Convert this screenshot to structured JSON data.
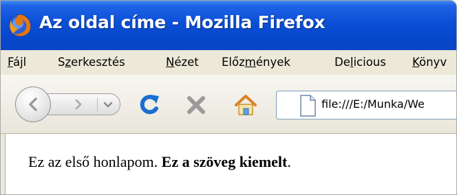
{
  "window": {
    "title": "Az oldal címe - Mozilla Firefox",
    "icon": "firefox-logo-icon"
  },
  "menubar": {
    "items": [
      {
        "pre": "",
        "acc": "F",
        "post": "ájl"
      },
      {
        "pre": "S",
        "acc": "z",
        "post": "erkesztés"
      },
      {
        "pre": "",
        "acc": "N",
        "post": "ézet"
      },
      {
        "pre": "Előz",
        "acc": "m",
        "post": "ények"
      },
      {
        "pre": "De",
        "acc": "l",
        "post": "icious"
      },
      {
        "pre": "",
        "acc": "K",
        "post": "önyv"
      }
    ]
  },
  "navbar": {
    "back_icon": "back-arrow-icon",
    "forward_icon": "forward-arrow-icon",
    "history_icon": "dropdown-arrow-icon",
    "reload_icon": "reload-icon",
    "stop_icon": "stop-icon",
    "home_icon": "home-icon",
    "page_icon": "page-icon",
    "url": "file:///E:/Munka/We"
  },
  "page": {
    "text_normal": "Ez az első honlapom. ",
    "text_bold": "Ez a szöveg kiemelt",
    "text_end": "."
  },
  "colors": {
    "titlebar": "#0747cc",
    "menubar": "#ece9d8",
    "reload": "#1a6fd0",
    "stop": "#9a9a9a"
  }
}
